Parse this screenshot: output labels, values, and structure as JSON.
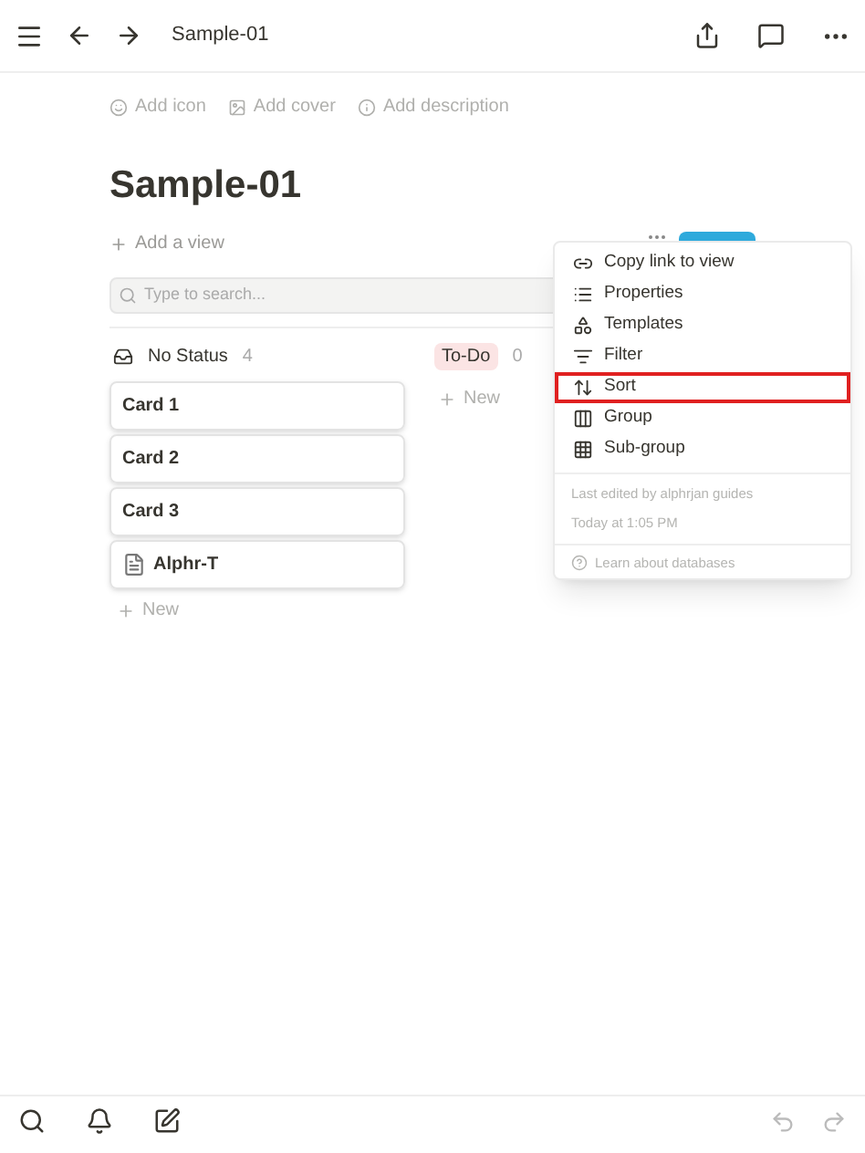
{
  "top_bar": {
    "title": "Sample-01"
  },
  "page_actions": [
    "Add icon",
    "Add cover",
    "Add description"
  ],
  "page": {
    "title": "Sample-01",
    "add_view": "Add a view",
    "search": {
      "placeholder": "Type to search..."
    }
  },
  "board": {
    "columns": [
      {
        "title": "No Status",
        "count": "4",
        "tagged": false,
        "cards": [
          {
            "title": "Card 1",
            "has_icon": false
          },
          {
            "title": "Card 2",
            "has_icon": false
          },
          {
            "title": "Card 3",
            "has_icon": false
          },
          {
            "title": "Alphr-T",
            "has_icon": true
          }
        ],
        "add": "New"
      },
      {
        "title": "To-Do",
        "count": "0",
        "tagged": true,
        "add": "New"
      }
    ]
  },
  "menu": {
    "items": [
      {
        "kind": "link",
        "label": "Copy link to view",
        "selected": false
      },
      {
        "kind": "properties",
        "label": "Properties",
        "selected": false
      },
      {
        "kind": "templates",
        "label": "Templates",
        "selected": false
      },
      {
        "kind": "filter",
        "label": "Filter",
        "selected": false
      },
      {
        "kind": "sort",
        "label": "Sort",
        "selected": true
      },
      {
        "kind": "group",
        "label": "Group",
        "selected": false
      },
      {
        "kind": "subgroup",
        "label": "Sub-group",
        "selected": false
      }
    ],
    "edited_by": "Last edited by alphrjan guides",
    "edited_at": "Today at 1:05 PM",
    "help": "Learn about databases"
  }
}
